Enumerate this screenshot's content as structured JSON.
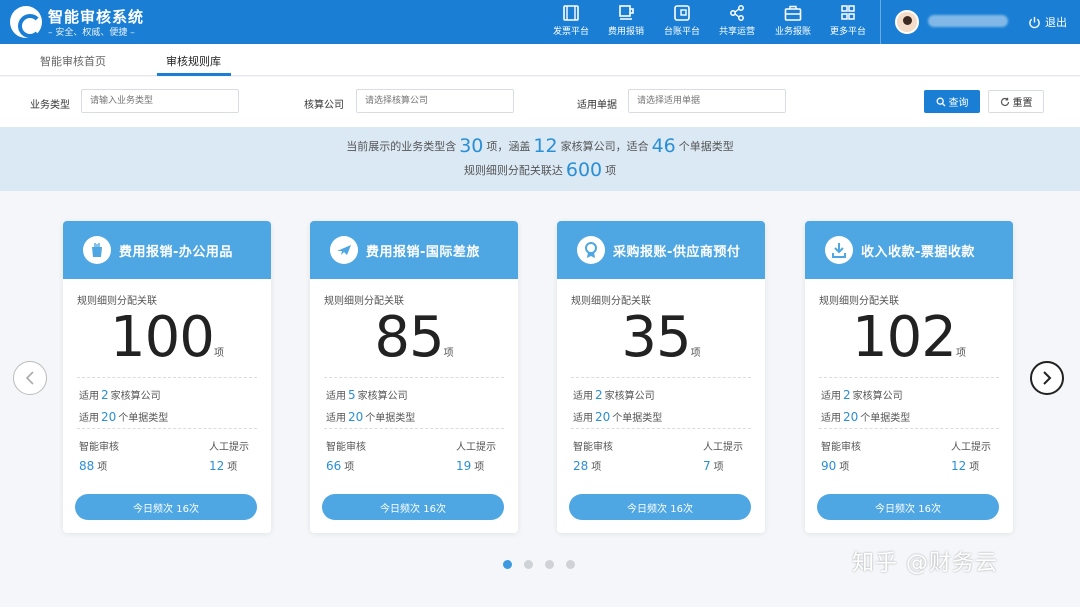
{
  "header": {
    "title": "智能审核系统",
    "subtitle": "– 安全、权威、便捷 –",
    "nav": [
      {
        "label": "发票平台",
        "icon": "invoice-icon"
      },
      {
        "label": "费用报销",
        "icon": "expense-icon"
      },
      {
        "label": "台账平台",
        "icon": "ledger-icon"
      },
      {
        "label": "共享运营",
        "icon": "share-icon"
      },
      {
        "label": "业务报账",
        "icon": "briefcase-icon"
      },
      {
        "label": "更多平台",
        "icon": "grid-icon"
      }
    ],
    "logout": "退出"
  },
  "tabs": [
    {
      "label": "智能审核首页",
      "active": false
    },
    {
      "label": "审核规则库",
      "active": true
    }
  ],
  "filters": {
    "business_type": {
      "label": "业务类型",
      "placeholder": "请输入业务类型"
    },
    "company": {
      "label": "核算公司",
      "placeholder": "请选择核算公司"
    },
    "document": {
      "label": "适用单据",
      "placeholder": "请选择适用单据"
    },
    "query_label": "查询",
    "reset_label": "重置"
  },
  "summary": {
    "t1": "当前展示的业务类型含",
    "n1": "30",
    "t2": "项，涵盖",
    "n2": "12",
    "t3": "家核算公司，适合",
    "n3": "46",
    "t4": "个单据类型",
    "t5": "规则细则分配关联达",
    "n4": "600",
    "t6": "项"
  },
  "cards": [
    {
      "title": "费用报销-办公用品",
      "icon": "office-supplies-icon",
      "caption": "规则细则分配关联",
      "count": "100",
      "unit": "项",
      "company_pre": "适用",
      "company_num": "2",
      "company_post": "家核算公司",
      "doc_pre": "适用",
      "doc_num": "20",
      "doc_post": "个单据类型",
      "smart_label": "智能审核",
      "smart_val": "88",
      "manual_label": "人工提示",
      "manual_val": "12",
      "item_unit": "项",
      "freq": "今日频次  16次"
    },
    {
      "title": "费用报销-国际差旅",
      "icon": "airplane-icon",
      "caption": "规则细则分配关联",
      "count": "85",
      "unit": "项",
      "company_pre": "适用",
      "company_num": "5",
      "company_post": "家核算公司",
      "doc_pre": "适用",
      "doc_num": "20",
      "doc_post": "个单据类型",
      "smart_label": "智能审核",
      "smart_val": "66",
      "manual_label": "人工提示",
      "manual_val": "19",
      "item_unit": "项",
      "freq": "今日频次  16次"
    },
    {
      "title": "采购报账-供应商预付",
      "icon": "medal-icon",
      "caption": "规则细则分配关联",
      "count": "35",
      "unit": "项",
      "company_pre": "适用",
      "company_num": "2",
      "company_post": "家核算公司",
      "doc_pre": "适用",
      "doc_num": "20",
      "doc_post": "个单据类型",
      "smart_label": "智能审核",
      "smart_val": "28",
      "manual_label": "人工提示",
      "manual_val": "7",
      "item_unit": "项",
      "freq": "今日频次  16次"
    },
    {
      "title": "收入收款-票据收款",
      "icon": "download-icon",
      "caption": "规则细则分配关联",
      "count": "102",
      "unit": "项",
      "company_pre": "适用",
      "company_num": "2",
      "company_post": "家核算公司",
      "doc_pre": "适用",
      "doc_num": "20",
      "doc_post": "个单据类型",
      "smart_label": "智能审核",
      "smart_val": "90",
      "manual_label": "人工提示",
      "manual_val": "12",
      "item_unit": "项",
      "freq": "今日频次  16次"
    }
  ],
  "pagination": {
    "pages": 4,
    "current": 1
  },
  "watermark": "知乎 @财务云",
  "colors": {
    "primary": "#1a7fd4",
    "card_header": "#4ea7e3",
    "highlight": "#2b8fd6",
    "summary_bg": "#dbe9f5"
  }
}
